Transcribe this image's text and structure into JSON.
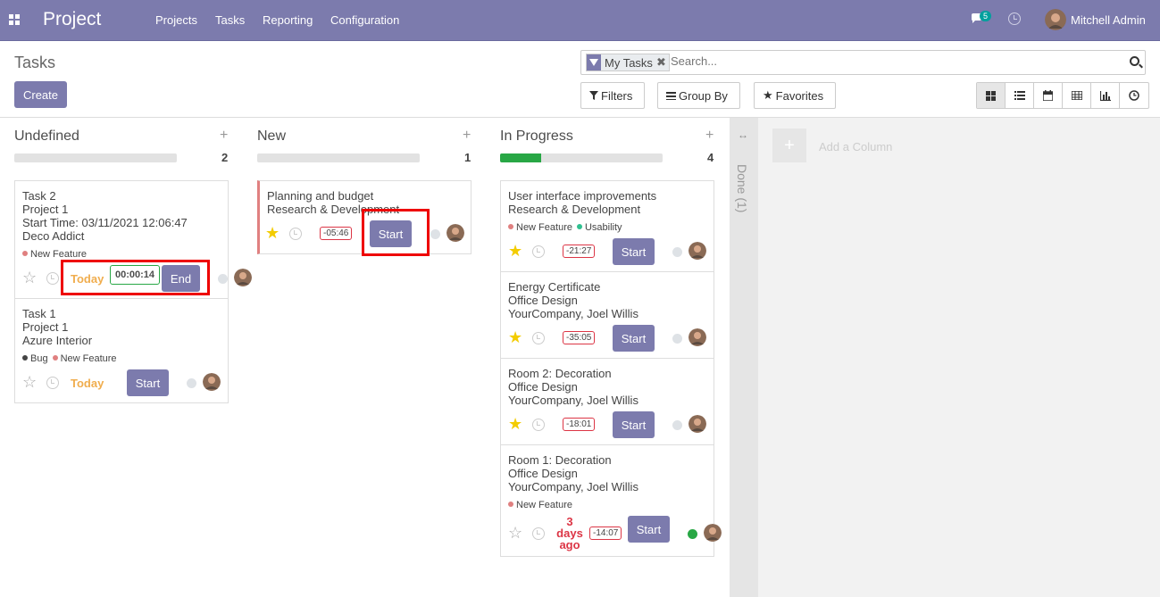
{
  "topbar": {
    "brand": "Project",
    "menu": [
      "Projects",
      "Tasks",
      "Reporting",
      "Configuration"
    ],
    "messages_count": "5",
    "user": "Mitchell Admin"
  },
  "control": {
    "breadcrumb": "Tasks",
    "create": "Create",
    "facet": "My Tasks",
    "facet_remove": "✖",
    "search_placeholder": "Search...",
    "filters": "Filters",
    "group_by": "Group By",
    "favorites": "Favorites"
  },
  "columns": [
    {
      "title": "Undefined",
      "count": "2",
      "progress": 0
    },
    {
      "title": "New",
      "count": "1",
      "progress": 0
    },
    {
      "title": "In Progress",
      "count": "4",
      "progress": 0.25
    }
  ],
  "folded_column": "Done (1)",
  "add_column": "Add a Column",
  "cards": {
    "task2": {
      "lines": [
        "Task 2",
        "Project 1",
        "Start Time: 03/11/2021 12:06:47",
        "Deco Addict"
      ],
      "tags": [
        "New Feature"
      ],
      "date": "Today",
      "timer": "00:00:14",
      "action": "End"
    },
    "task1": {
      "lines": [
        "Task 1",
        "Project 1",
        "Azure Interior"
      ],
      "tags": [
        "Bug",
        "New Feature"
      ],
      "date": "Today",
      "action": "Start"
    },
    "planning": {
      "lines": [
        "Planning and budget",
        "Research & Development"
      ],
      "timer": "-05:46",
      "action": "Start"
    },
    "ui": {
      "lines": [
        "User interface improvements",
        "Research & Development"
      ],
      "tags": [
        "New Feature",
        "Usability"
      ],
      "timer": "-21:27",
      "action": "Start"
    },
    "energy": {
      "lines": [
        "Energy Certificate",
        "Office Design",
        "YourCompany, Joel Willis"
      ],
      "timer": "-35:05",
      "action": "Start"
    },
    "room2": {
      "lines": [
        "Room 2: Decoration",
        "Office Design",
        "YourCompany, Joel Willis"
      ],
      "timer": "-18:01",
      "action": "Start"
    },
    "room1": {
      "lines": [
        "Room 1: Decoration",
        "Office Design",
        "YourCompany, Joel Willis"
      ],
      "tags": [
        "New Feature"
      ],
      "date": "3 days ago",
      "timer": "-14:07",
      "action": "Start"
    }
  },
  "colors": {
    "brand": "#7c7bad",
    "tag_new_feature": "#e08080",
    "tag_usability": "#30c090",
    "tag_bug": "#444444",
    "progress_green": "#28a745"
  }
}
